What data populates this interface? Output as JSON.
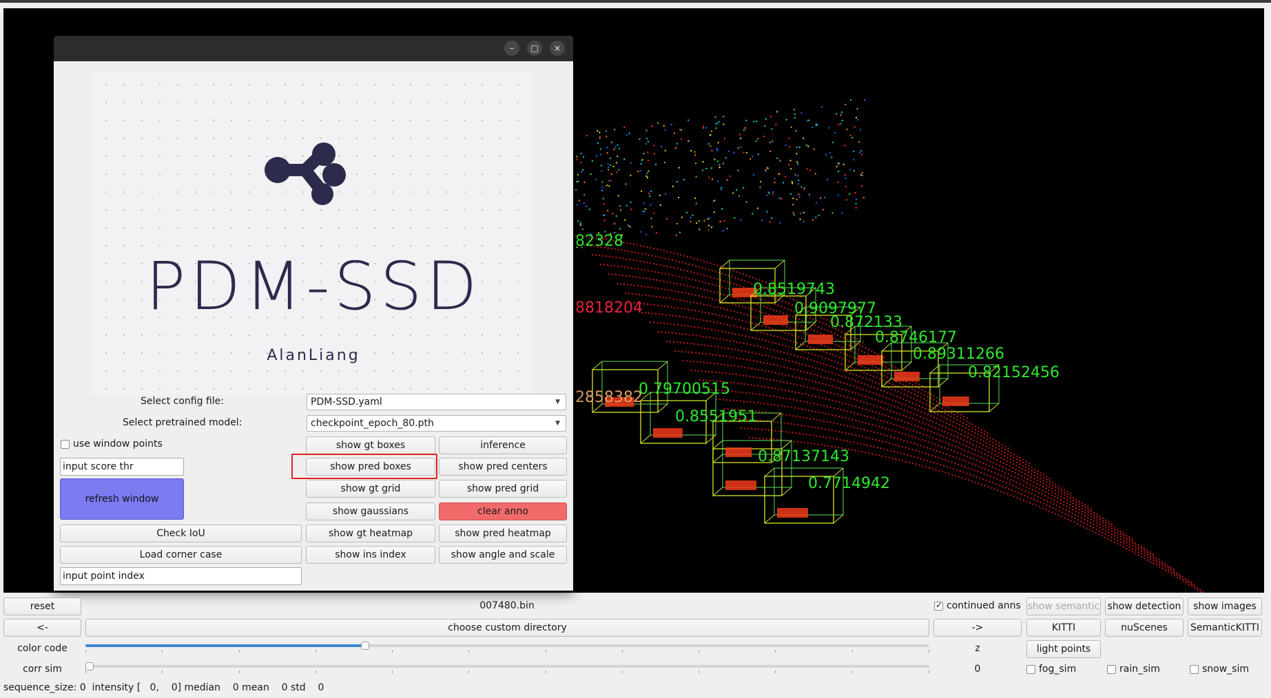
{
  "logo": {
    "title": "PDM-SSD",
    "author": "AlanLiang"
  },
  "dialog": {
    "config_label": "Select config file:",
    "config_value": "PDM-SSD.yaml",
    "model_label": "Select pretrained model:",
    "model_value": "checkpoint_epoch_80.pth",
    "use_window_points": "use window points",
    "score_thr_value": "input score thr",
    "refresh_window": "refresh window",
    "check_iou": "Check IoU",
    "load_corner_case": "Load corner case",
    "point_index_value": "input point index",
    "buttons": {
      "show_gt_boxes": "show gt boxes",
      "inference": "inference",
      "show_pred_boxes": "show pred boxes",
      "show_pred_centers": "show pred centers",
      "show_gt_grid": "show gt grid",
      "show_pred_grid": "show pred grid",
      "show_gaussians": "show gaussians",
      "clear_anno": "clear anno",
      "show_gt_heatmap": "show gt heatmap",
      "show_pred_heatmap": "show pred heatmap",
      "show_ins_index": "show ins index",
      "show_angle_and_scale": "show angle and scale"
    },
    "window_controls": {
      "minimize": "–",
      "maximize": "□",
      "close": "×"
    }
  },
  "viewer": {
    "score_labels": [
      {
        "text": "82328",
        "color": "#2ee82e"
      },
      {
        "text": "8818204",
        "color": "#e8243c"
      },
      {
        "text": "2858382",
        "color": "#e0a060"
      },
      {
        "text": "0.8519743",
        "color": "#2ee82e"
      },
      {
        "text": "0.9097977",
        "color": "#2ee82e"
      },
      {
        "text": "0.872133",
        "color": "#2ee82e"
      },
      {
        "text": "0.8746177",
        "color": "#2ee82e"
      },
      {
        "text": "0.89311266",
        "color": "#2ee82e"
      },
      {
        "text": "0.82152456",
        "color": "#2ee82e"
      },
      {
        "text": "0.79700515",
        "color": "#2ee82e"
      },
      {
        "text": "0.8551951",
        "color": "#2ee82e"
      },
      {
        "text": "0.87137143",
        "color": "#2ee82e"
      },
      {
        "text": "0.7714942",
        "color": "#2ee82e"
      }
    ]
  },
  "bottom": {
    "reset": "reset",
    "filename": "007480.bin",
    "continued_anns": "continued anns",
    "show_semantic": "show semantic",
    "show_detection": "show detection",
    "show_images": "show images",
    "prev": "<-",
    "choose_custom_directory": "choose custom directory",
    "next": "->",
    "kitti": "KITTI",
    "nuscenes": "nuScenes",
    "semantickitti": "SemanticKITTI",
    "color_code": "color code",
    "z_label": "z",
    "light_points": "light points",
    "corr_sim": "corr sim",
    "corr_value": "0",
    "fog_sim": "fog_sim",
    "rain_sim": "rain_sim",
    "snow_sim": "snow_sim",
    "color_code_slider_fraction": 0.33,
    "corr_sim_slider_fraction": 0.0,
    "status": "sequence_size: 0  intensity [   0,    0] median    0 mean    0 std    0"
  }
}
